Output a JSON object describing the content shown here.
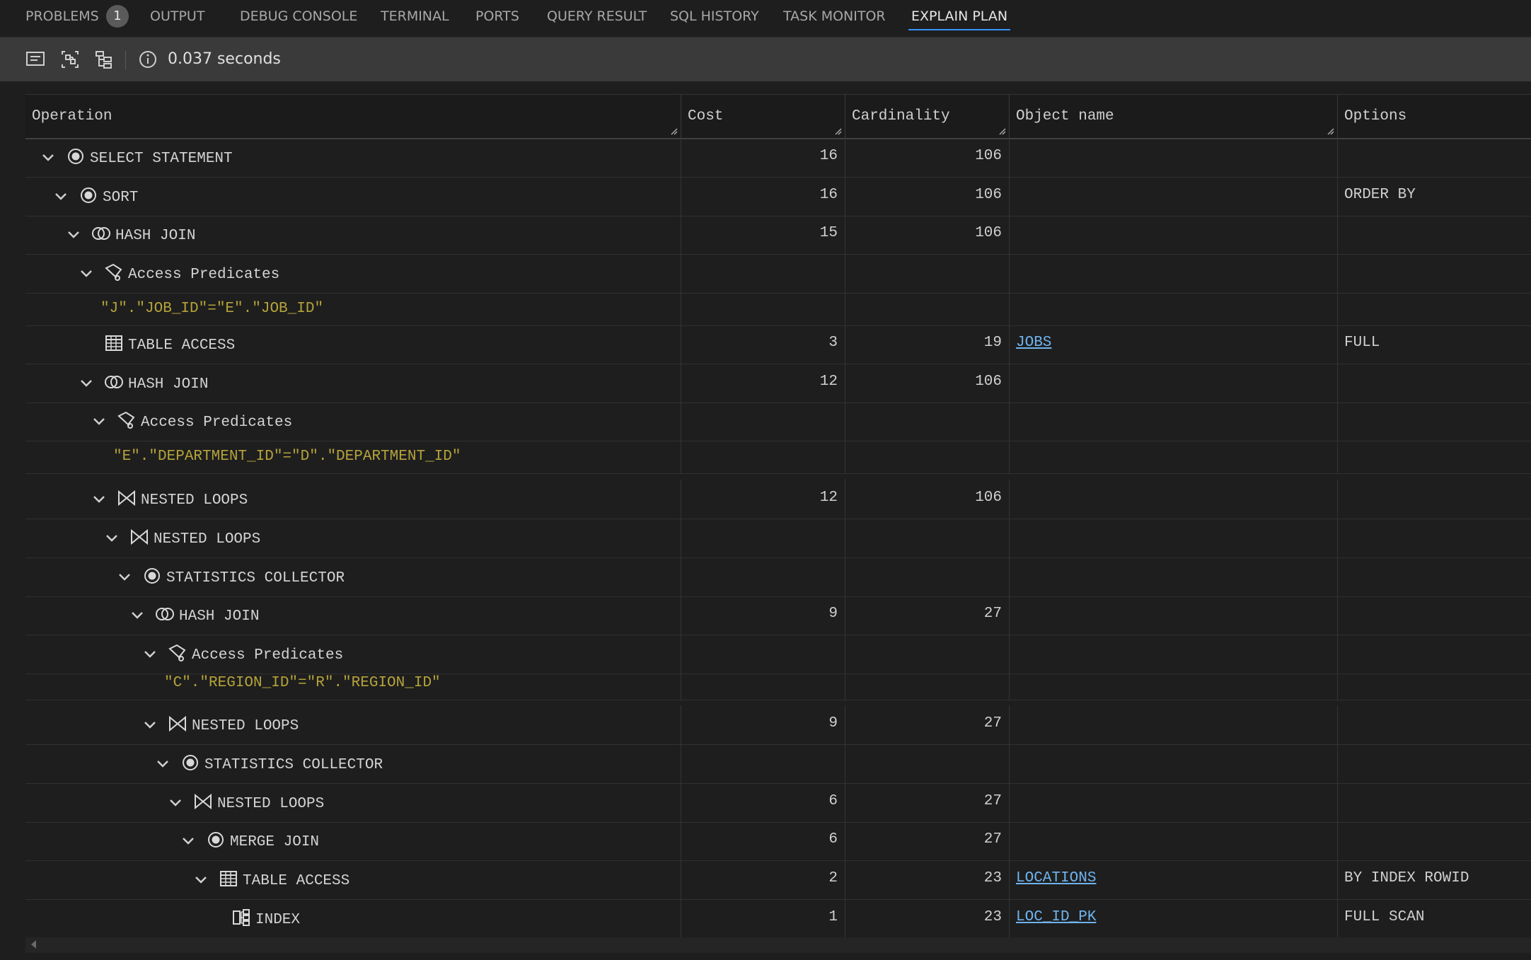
{
  "tabs": [
    {
      "label": "PROBLEMS",
      "badge": "1"
    },
    {
      "label": "OUTPUT"
    },
    {
      "label": "DEBUG CONSOLE"
    },
    {
      "label": "TERMINAL"
    },
    {
      "label": "PORTS"
    },
    {
      "label": "QUERY RESULT"
    },
    {
      "label": "SQL HISTORY"
    },
    {
      "label": "TASK MONITOR"
    },
    {
      "label": "EXPLAIN PLAN",
      "active": true
    }
  ],
  "toolbar": {
    "icons": [
      "text-view-icon",
      "diagram-view-icon",
      "tree-view-icon"
    ],
    "elapsed": "0.037 seconds"
  },
  "columns": [
    "Operation",
    "Cost",
    "Cardinality",
    "Object name",
    "Options"
  ],
  "rows": [
    {
      "level": 0,
      "expandable": true,
      "icon": "circle",
      "label": "SELECT STATEMENT",
      "cost": "16",
      "card": "106",
      "object": "",
      "options": ""
    },
    {
      "level": 1,
      "expandable": true,
      "icon": "circle",
      "label": "SORT",
      "cost": "16",
      "card": "106",
      "object": "",
      "options": "ORDER BY"
    },
    {
      "level": 2,
      "expandable": true,
      "icon": "hashjoin",
      "label": "HASH JOIN",
      "cost": "15",
      "card": "106",
      "object": "",
      "options": ""
    },
    {
      "level": 3,
      "expandable": true,
      "icon": "predicate",
      "label": "Access Predicates",
      "cost": "",
      "card": "",
      "object": "",
      "options": ""
    },
    {
      "level": 3,
      "kind": "predicate-text",
      "label": "\"J\".\"JOB_ID\"=\"E\".\"JOB_ID\""
    },
    {
      "level": 3,
      "expandable": false,
      "icon": "table",
      "label": "TABLE ACCESS",
      "cost": "3",
      "card": "19",
      "object": "JOBS",
      "options": "FULL"
    },
    {
      "level": 3,
      "expandable": true,
      "icon": "hashjoin",
      "label": "HASH JOIN",
      "cost": "12",
      "card": "106",
      "object": "",
      "options": ""
    },
    {
      "level": 4,
      "expandable": true,
      "icon": "predicate",
      "label": "Access Predicates",
      "cost": "",
      "card": "",
      "object": "",
      "options": ""
    },
    {
      "level": 4,
      "kind": "predicate-text",
      "label": "\"E\".\"DEPARTMENT_ID\"=\"D\".\"DEPARTMENT_ID\""
    },
    {
      "level": 4,
      "expandable": true,
      "icon": "bowtie",
      "label": "NESTED LOOPS",
      "cost": "12",
      "card": "106",
      "object": "",
      "options": ""
    },
    {
      "level": 5,
      "expandable": true,
      "icon": "bowtie",
      "label": "NESTED LOOPS",
      "cost": "",
      "card": "",
      "object": "",
      "options": ""
    },
    {
      "level": 6,
      "expandable": true,
      "icon": "circle",
      "label": "STATISTICS COLLECTOR",
      "cost": "",
      "card": "",
      "object": "",
      "options": ""
    },
    {
      "level": 7,
      "expandable": true,
      "icon": "hashjoin",
      "label": "HASH JOIN",
      "cost": "9",
      "card": "27",
      "object": "",
      "options": ""
    },
    {
      "level": 8,
      "expandable": true,
      "icon": "predicate",
      "label": "Access Predicates",
      "cost": "",
      "card": "",
      "object": "",
      "options": ""
    },
    {
      "level": 8,
      "kind": "predicate-text",
      "label": "\"C\".\"REGION_ID\"=\"R\".\"REGION_ID\""
    },
    {
      "level": 8,
      "expandable": true,
      "icon": "bowtie",
      "label": "NESTED LOOPS",
      "cost": "9",
      "card": "27",
      "object": "",
      "options": ""
    },
    {
      "level": 9,
      "expandable": true,
      "icon": "circle",
      "label": "STATISTICS COLLECTOR",
      "cost": "",
      "card": "",
      "object": "",
      "options": ""
    },
    {
      "level": 10,
      "expandable": true,
      "icon": "bowtie",
      "label": "NESTED LOOPS",
      "cost": "6",
      "card": "27",
      "object": "",
      "options": ""
    },
    {
      "level": 11,
      "expandable": true,
      "icon": "circle",
      "label": "MERGE JOIN",
      "cost": "6",
      "card": "27",
      "object": "",
      "options": ""
    },
    {
      "level": 12,
      "expandable": true,
      "icon": "table",
      "label": "TABLE ACCESS",
      "cost": "2",
      "card": "23",
      "object": "LOCATIONS",
      "options": "BY INDEX ROWID"
    },
    {
      "level": 13,
      "expandable": false,
      "icon": "index",
      "label": "INDEX",
      "cost": "1",
      "card": "23",
      "object": "LOC_ID_PK",
      "options": "FULL SCAN"
    }
  ],
  "colors": {
    "background": "#1e1e1e",
    "toolbar": "#3a3a3a",
    "accent": "#3794ff",
    "link": "#6fb3ee",
    "predicate": "#b5a33a"
  }
}
